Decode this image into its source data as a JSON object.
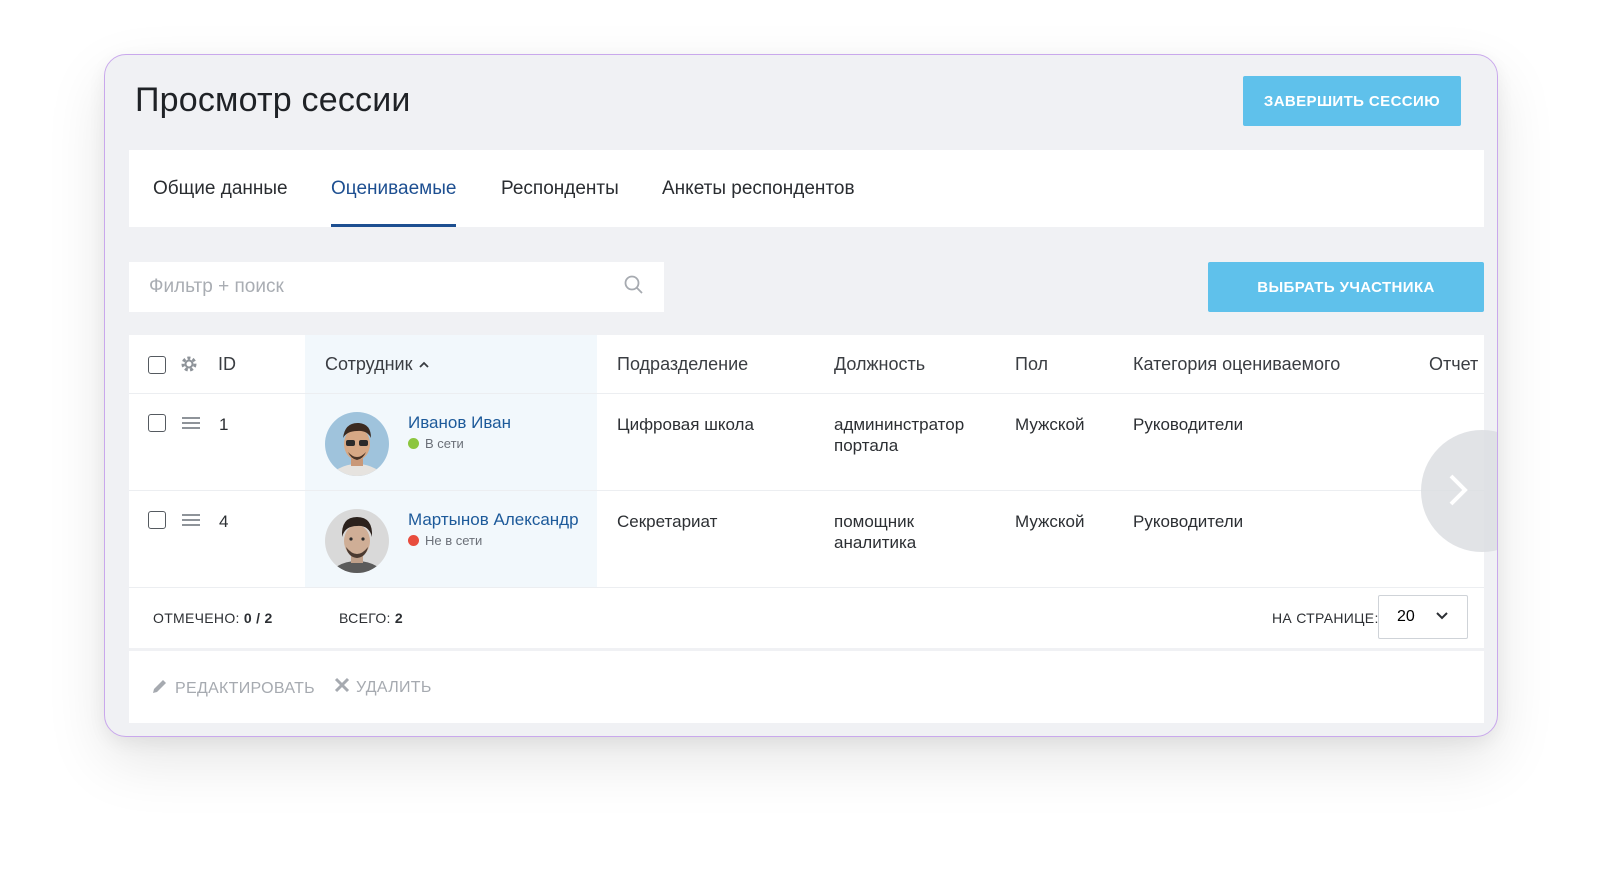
{
  "page": {
    "title": "Просмотр сессии",
    "finish_button": "ЗАВЕРШИТЬ СЕССИЮ"
  },
  "tabs": [
    {
      "label": "Общие данные",
      "active": false
    },
    {
      "label": "Оцениваемые",
      "active": true
    },
    {
      "label": "Респонденты",
      "active": false
    },
    {
      "label": "Анкеты респондентов",
      "active": false
    }
  ],
  "search": {
    "placeholder": "Фильтр + поиск",
    "value": ""
  },
  "select_button": "ВЫБРАТЬ УЧАСТНИКА",
  "table": {
    "headers": {
      "id": "ID",
      "employee": "Сотрудник",
      "department": "Подразделение",
      "position": "Должность",
      "gender": "Пол",
      "category": "Категория оцениваемого",
      "report": "Отчет"
    },
    "sort": {
      "column": "employee",
      "direction": "asc",
      "icon": "chevron-up-icon"
    },
    "rows": [
      {
        "id": "1",
        "name": "Иванов Иван",
        "status": "В сети",
        "status_color": "#8cc63f",
        "department": "Цифровая школа",
        "position_line1": "админинстратор",
        "position_line2": "портала",
        "gender": "Мужской",
        "category": "Руководители"
      },
      {
        "id": "4",
        "name": "Мартынов Александр",
        "status": "Не в сети",
        "status_color": "#e84c3d",
        "department": "Секретариат",
        "position_line1": "помощник",
        "position_line2": "аналитика",
        "gender": "Мужской",
        "category": "Руководители"
      }
    ]
  },
  "footer": {
    "checked_label": "ОТМЕЧЕНО:",
    "checked_value": "0 / 2",
    "total_label": "ВСЕГО:",
    "total_value": "2",
    "per_page_label": "НА СТРАНИЦЕ:",
    "per_page_value": "20"
  },
  "actions": {
    "edit": "РЕДАКТИРОВАТЬ",
    "delete": "УДАЛИТЬ"
  },
  "colors": {
    "accent": "#5fc1eb",
    "active_tab": "#1d4f91",
    "link": "#1d5a9a",
    "frame_border": "#c9a8ec"
  }
}
